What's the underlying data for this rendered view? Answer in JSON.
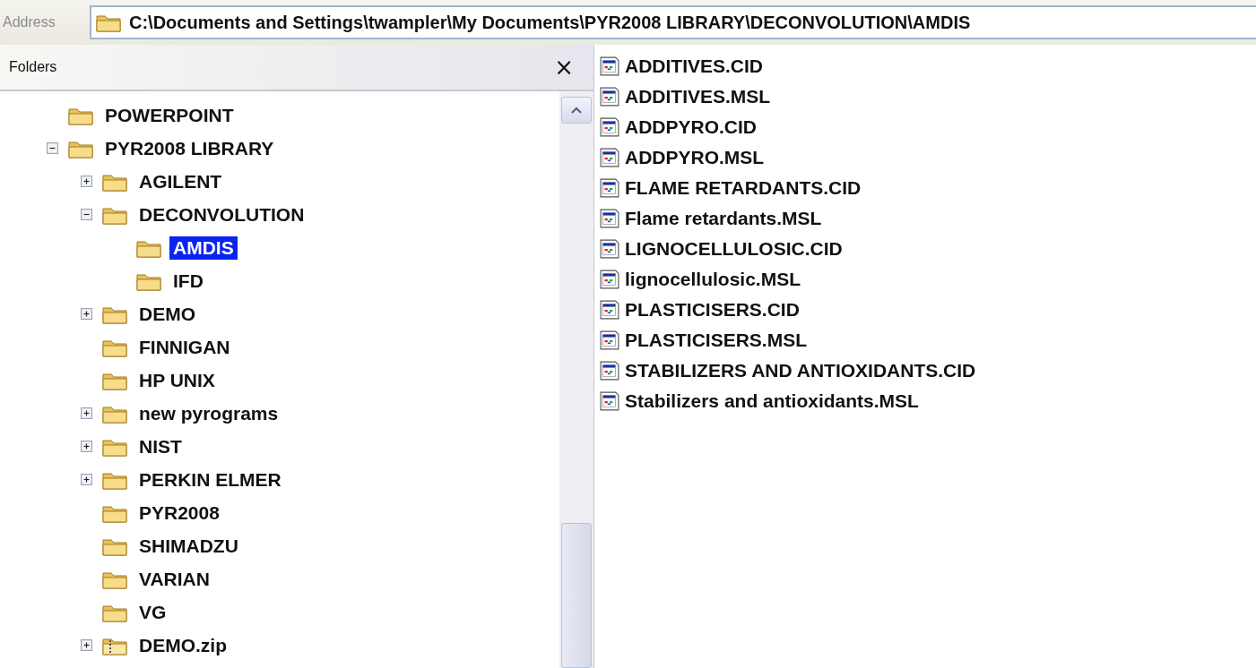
{
  "address_bar": {
    "label": "Address",
    "value": "C:\\Documents and Settings\\twampler\\My Documents\\PYR2008 LIBRARY\\DECONVOLUTION\\AMDIS"
  },
  "folders_pane": {
    "title": "Folders",
    "close": "×",
    "tree": [
      {
        "label": "POWERPOINT",
        "kind": "folder",
        "selected": false
      },
      {
        "label": "PYR2008 LIBRARY",
        "kind": "folder",
        "selected": false,
        "expanded": true,
        "children": [
          {
            "label": "AGILENT",
            "kind": "folder",
            "selected": false,
            "expanded": false
          },
          {
            "label": "DECONVOLUTION",
            "kind": "folder",
            "selected": false,
            "expanded": true,
            "children": [
              {
                "label": "AMDIS",
                "kind": "folder",
                "selected": true
              },
              {
                "label": "IFD",
                "kind": "folder",
                "selected": false
              }
            ]
          },
          {
            "label": "DEMO",
            "kind": "folder",
            "selected": false,
            "expanded": false
          },
          {
            "label": "FINNIGAN",
            "kind": "folder",
            "selected": false
          },
          {
            "label": "HP UNIX",
            "kind": "folder",
            "selected": false
          },
          {
            "label": "new pyrograms",
            "kind": "folder",
            "selected": false,
            "expanded": false
          },
          {
            "label": "NIST",
            "kind": "folder",
            "selected": false,
            "expanded": false
          },
          {
            "label": "PERKIN ELMER",
            "kind": "folder",
            "selected": false,
            "expanded": false
          },
          {
            "label": "PYR2008",
            "kind": "folder",
            "selected": false
          },
          {
            "label": "SHIMADZU",
            "kind": "folder",
            "selected": false
          },
          {
            "label": "VARIAN",
            "kind": "folder",
            "selected": false
          },
          {
            "label": "VG",
            "kind": "folder",
            "selected": false
          },
          {
            "label": "DEMO.zip",
            "kind": "zip",
            "selected": false,
            "expanded": false
          }
        ]
      }
    ]
  },
  "files": [
    {
      "name": "ADDITIVES.CID"
    },
    {
      "name": "ADDITIVES.MSL"
    },
    {
      "name": "ADDPYRO.CID"
    },
    {
      "name": "ADDPYRO.MSL"
    },
    {
      "name": "FLAME RETARDANTS.CID"
    },
    {
      "name": "Flame retardants.MSL"
    },
    {
      "name": "LIGNOCELLULOSIC.CID"
    },
    {
      "name": "lignocellulosic.MSL"
    },
    {
      "name": "PLASTICISERS.CID"
    },
    {
      "name": "PLASTICISERS.MSL"
    },
    {
      "name": "STABILIZERS AND ANTIOXIDANTS.CID"
    },
    {
      "name": "Stabilizers and antioxidants.MSL"
    }
  ]
}
